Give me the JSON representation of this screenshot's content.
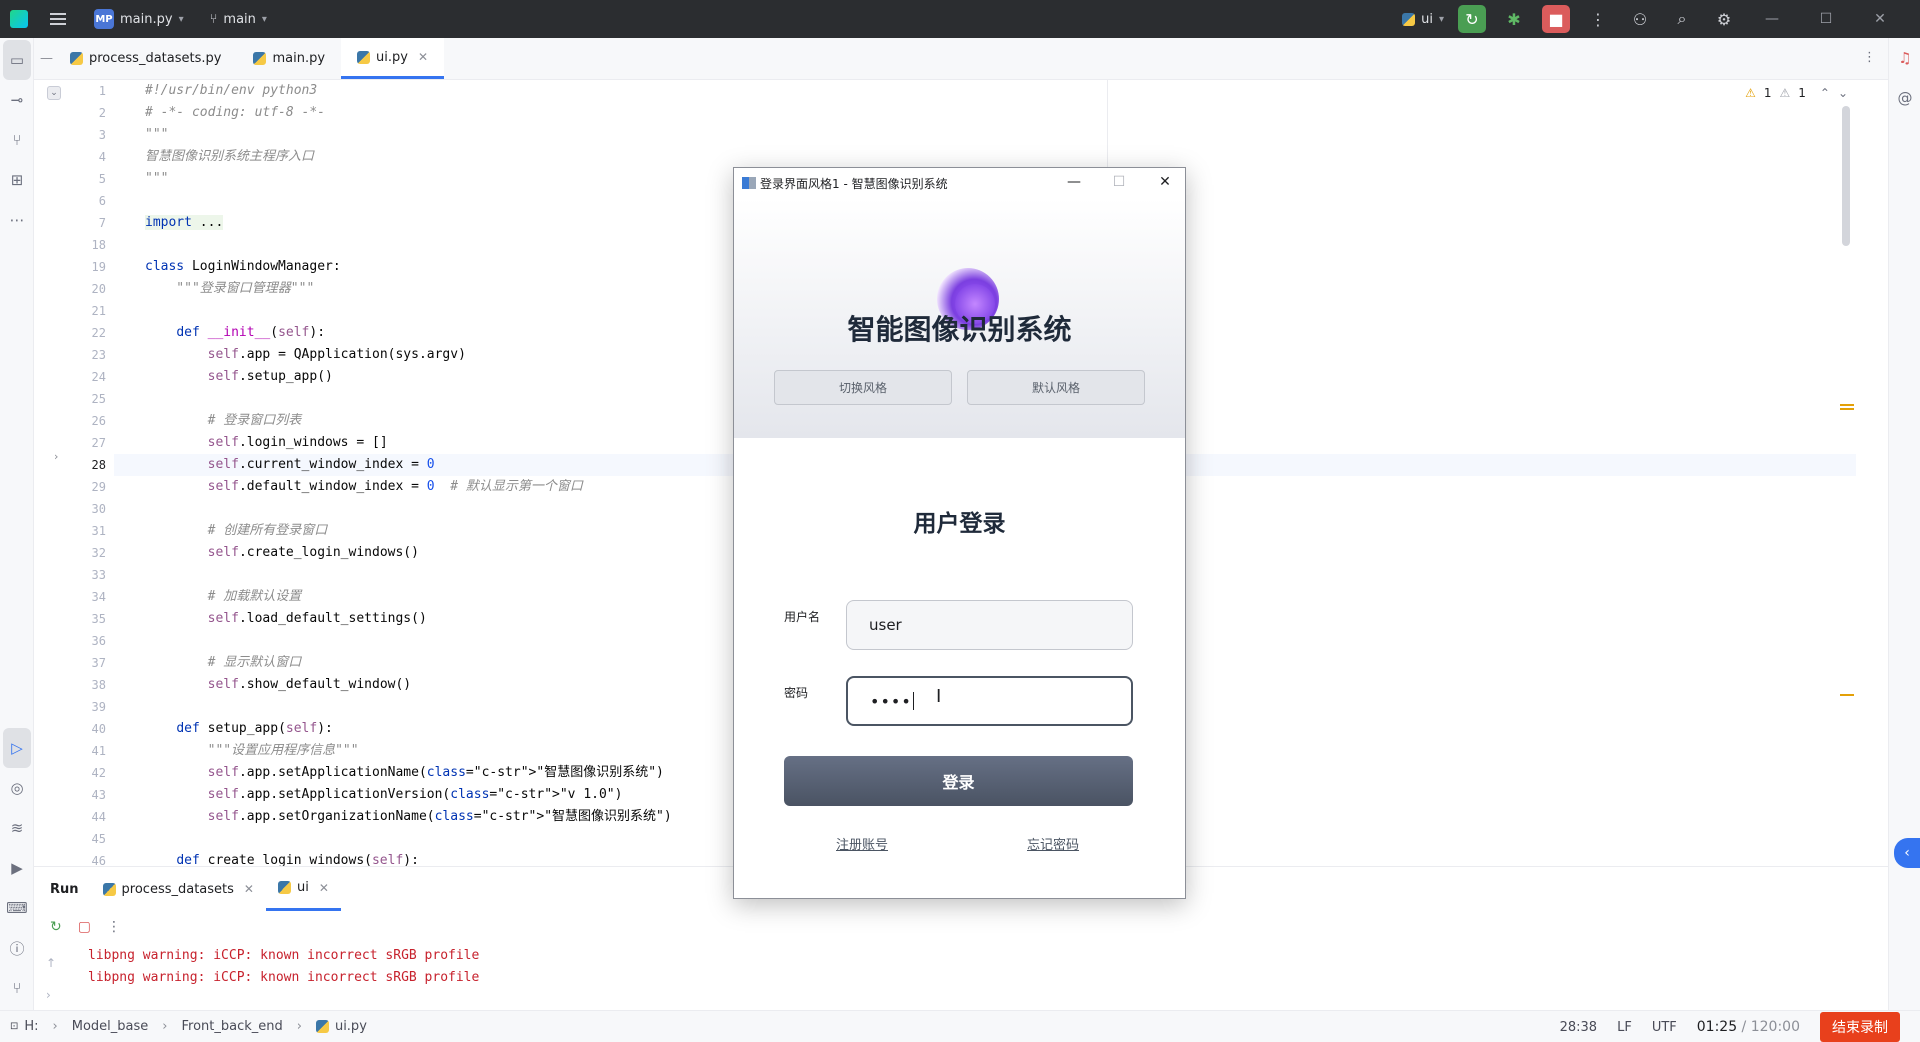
{
  "titlebar": {
    "project_badge": "MP",
    "project_name": "main.py",
    "branch": "main",
    "interpreter": "ui"
  },
  "editor_tabs": [
    {
      "label": "process_datasets.py"
    },
    {
      "label": "main.py"
    },
    {
      "label": "ui.py"
    }
  ],
  "inspections": {
    "warnings_a": "1",
    "warnings_b": "1"
  },
  "code": {
    "line_numbers": [
      "1",
      "2",
      "3",
      "4",
      "5",
      "6",
      "7",
      "18",
      "19",
      "20",
      "21",
      "22",
      "23",
      "24",
      "25",
      "26",
      "27",
      "28",
      "29",
      "30",
      "31",
      "32",
      "33",
      "34",
      "35",
      "36",
      "37",
      "38",
      "39",
      "40",
      "41",
      "42",
      "43",
      "44",
      "45",
      "46"
    ],
    "lines": [
      "#!/usr/bin/env python3",
      "# -*- coding: utf-8 -*-",
      "\"\"\"",
      "智慧图像识别系统主程序入口",
      "\"\"\"",
      "",
      "import ...",
      "",
      "class LoginWindowManager:",
      "    \"\"\"登录窗口管理器\"\"\"",
      "",
      "    def __init__(self):",
      "        self.app = QApplication(sys.argv)",
      "        self.setup_app()",
      "",
      "        # 登录窗口列表",
      "        self.login_windows = []",
      "        self.current_window_index = 0",
      "        self.default_window_index = 0  # 默认显示第一个窗口",
      "",
      "        # 创建所有登录窗口",
      "        self.create_login_windows()",
      "",
      "        # 加载默认设置",
      "        self.load_default_settings()",
      "",
      "        # 显示默认窗口",
      "        self.show_default_window()",
      "",
      "    def setup_app(self):",
      "        \"\"\"设置应用程序信息\"\"\"",
      "        self.app.setApplicationName(\"智慧图像识别系统\")",
      "        self.app.setApplicationVersion(\"v 1.0\")",
      "        self.app.setOrganizationName(\"智慧图像识别系统\")",
      "",
      "    def create_login_windows(self):"
    ]
  },
  "run_panel": {
    "title": "Run",
    "tabs": [
      {
        "label": "process_datasets"
      },
      {
        "label": "ui"
      }
    ],
    "console": [
      "libpng warning: iCCP: known incorrect sRGB profile",
      "libpng warning: iCCP: known incorrect sRGB profile"
    ]
  },
  "statusbar": {
    "breadcrumb": [
      "H:",
      "Model_base",
      "Front_back_end",
      "ui.py"
    ],
    "position": "28:38",
    "line_sep": "LF",
    "encoding": "UTF",
    "timer_elapsed": "01:25",
    "timer_sep": " / ",
    "timer_total": "120:00",
    "stop_recording": "结束录制"
  },
  "dialog": {
    "window_title": "登录界面风格1 - 智慧图像识别系统",
    "system_title": "智能图像识别系统",
    "switch_style": "切换风格",
    "default_style": "默认风格",
    "login_heading": "用户登录",
    "username_label": "用户名",
    "username_value": "user",
    "password_label": "密码",
    "password_value": "••••",
    "login_button": "登录",
    "register_link": "注册账号",
    "forgot_link": "忘记密码",
    "accent_color": "#4a5363"
  }
}
